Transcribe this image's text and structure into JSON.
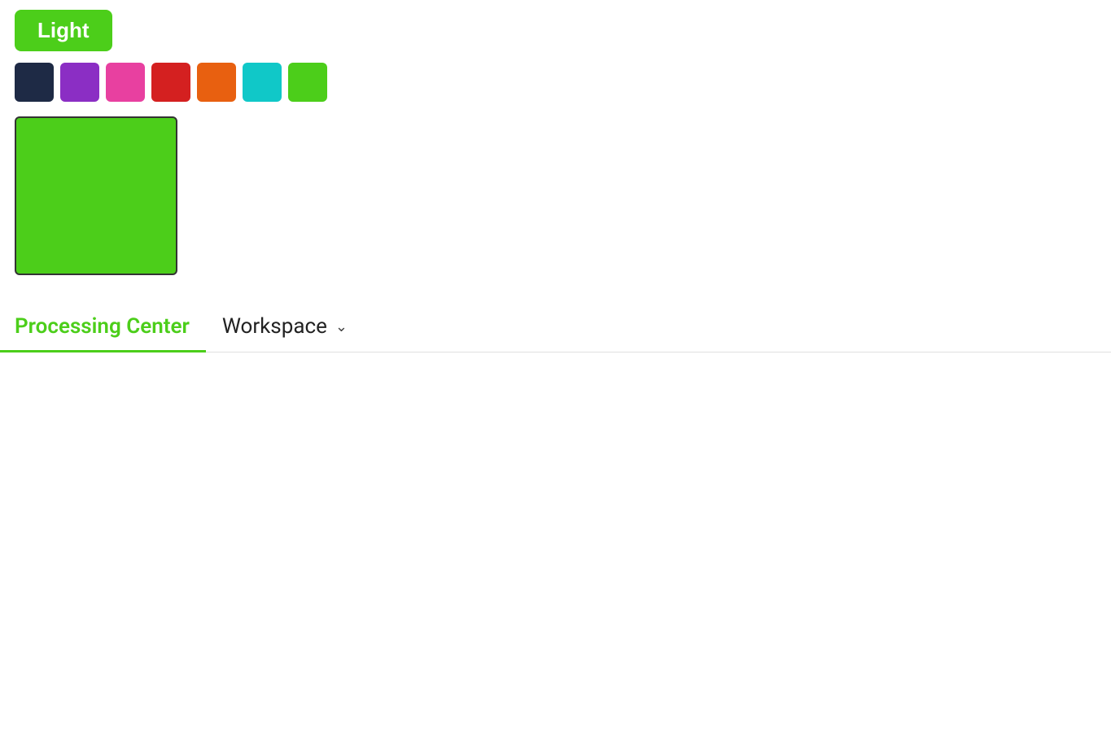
{
  "button": {
    "label": "Light"
  },
  "swatches": [
    {
      "color": "#1e2a45",
      "name": "dark-navy"
    },
    {
      "color": "#8b2ec4",
      "name": "purple"
    },
    {
      "color": "#e840a0",
      "name": "hot-pink"
    },
    {
      "color": "#d42020",
      "name": "red"
    },
    {
      "color": "#e86010",
      "name": "orange"
    },
    {
      "color": "#10c8c8",
      "name": "cyan"
    },
    {
      "color": "#4cce1a",
      "name": "green"
    }
  ],
  "selected_color": "#4cce1a",
  "tabs": [
    {
      "label": "Processing Center",
      "active": true
    },
    {
      "label": "Workspace",
      "active": false,
      "has_dropdown": true
    }
  ],
  "chevron": "⌄"
}
